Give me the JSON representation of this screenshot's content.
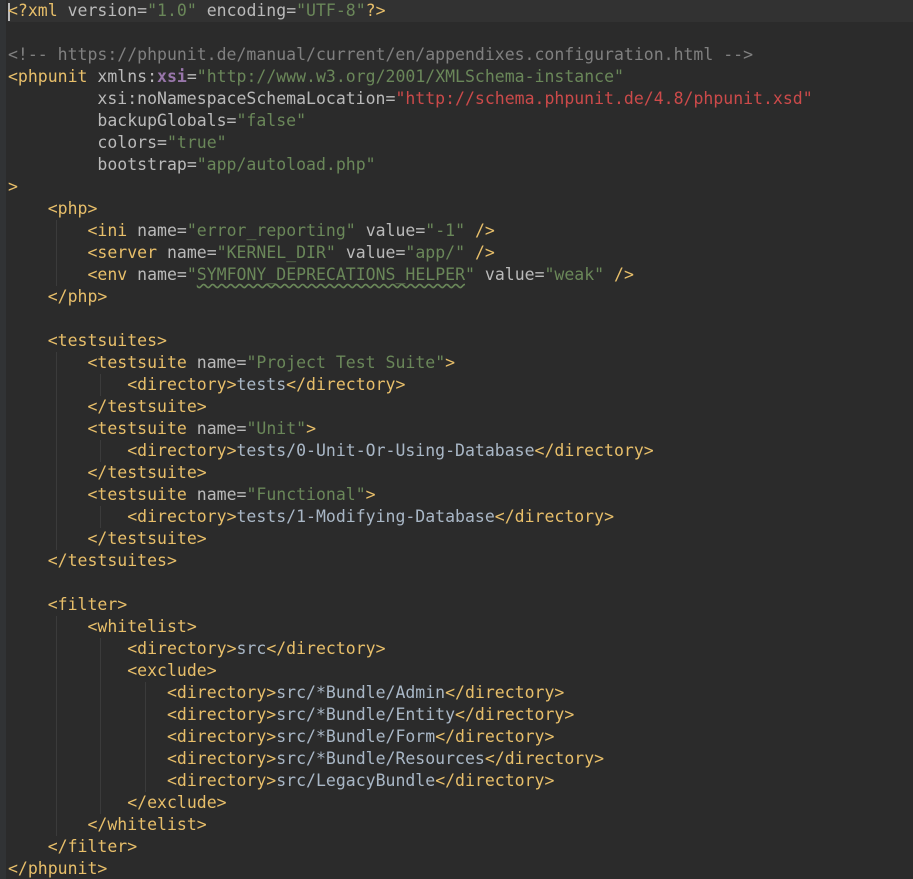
{
  "editor": {
    "language": "xml",
    "colors": {
      "background": "#2b2b2b",
      "tag": "#e8bf6a",
      "attribute": "#bababa",
      "value": "#6a8759",
      "comment": "#808080",
      "text": "#a9b7c6",
      "namespace": "#9876aa",
      "schema_url": "#cc4a4a"
    },
    "lines": [
      "<?xml version=\"1.0\" encoding=\"UTF-8\"?>",
      "",
      "<!-- https://phpunit.de/manual/current/en/appendixes.configuration.html -->",
      "<phpunit xmlns:xsi=\"http://www.w3.org/2001/XMLSchema-instance\"",
      "         xsi:noNamespaceSchemaLocation=\"http://schema.phpunit.de/4.8/phpunit.xsd\"",
      "         backupGlobals=\"false\"",
      "         colors=\"true\"",
      "         bootstrap=\"app/autoload.php\"",
      ">",
      "    <php>",
      "        <ini name=\"error_reporting\" value=\"-1\" />",
      "        <server name=\"KERNEL_DIR\" value=\"app/\" />",
      "        <env name=\"SYMFONY_DEPRECATIONS_HELPER\" value=\"weak\" />",
      "    </php>",
      "",
      "    <testsuites>",
      "        <testsuite name=\"Project Test Suite\">",
      "            <directory>tests</directory>",
      "        </testsuite>",
      "        <testsuite name=\"Unit\">",
      "            <directory>tests/0-Unit-Or-Using-Database</directory>",
      "        </testsuite>",
      "        <testsuite name=\"Functional\">",
      "            <directory>tests/1-Modifying-Database</directory>",
      "        </testsuite>",
      "    </testsuites>",
      "",
      "    <filter>",
      "        <whitelist>",
      "            <directory>src</directory>",
      "            <exclude>",
      "                <directory>src/*Bundle/Admin</directory>",
      "                <directory>src/*Bundle/Entity</directory>",
      "                <directory>src/*Bundle/Form</directory>",
      "                <directory>src/*Bundle/Resources</directory>",
      "                <directory>src/LegacyBundle</directory>",
      "            </exclude>",
      "        </whitelist>",
      "    </filter>",
      "</phpunit>"
    ]
  }
}
